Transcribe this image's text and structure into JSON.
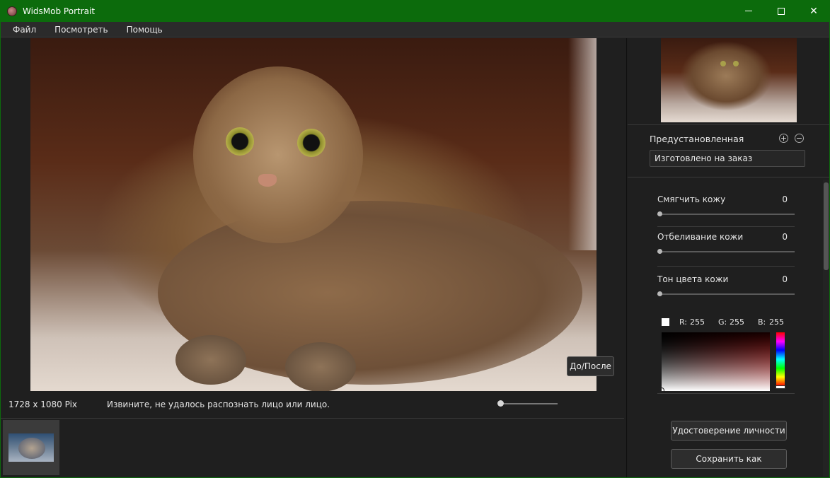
{
  "window": {
    "title": "WidsMob Portrait",
    "minimize": "minimize",
    "maximize": "maximize",
    "close": "✕"
  },
  "menu": [
    "Файл",
    "Посмотреть",
    "Помощь"
  ],
  "status": {
    "dimensions": "1728 x 1080 Pix",
    "message": "Извините, не удалось распознать лицо или лицо.",
    "zoom": 0
  },
  "buttons": {
    "before_after": "До/После",
    "identity": "Удостоверение личности",
    "save_as": "Сохранить как"
  },
  "preset": {
    "label": "Предустановленная",
    "plus": "+",
    "minus": "−",
    "selected": "Изготовлено на заказ"
  },
  "adjustments": [
    {
      "label": "Смягчить кожу",
      "value": "0"
    },
    {
      "label": "Отбеливание кожи",
      "value": "0"
    },
    {
      "label": "Тон цвета кожи",
      "value": "0"
    }
  ],
  "color": {
    "swatch": "#ffffff",
    "r_label": "R:",
    "r": "255",
    "g_label": "G:",
    "g": "255",
    "b_label": "B:",
    "b": "255"
  },
  "colors": {
    "titlebar": "#0c6b0c",
    "background": "#1e1e1e",
    "panel": "#1f1f1f"
  },
  "icons": {
    "app": "portrait-app-icon",
    "plus": "plus-circle-icon",
    "minus": "minus-circle-icon"
  }
}
